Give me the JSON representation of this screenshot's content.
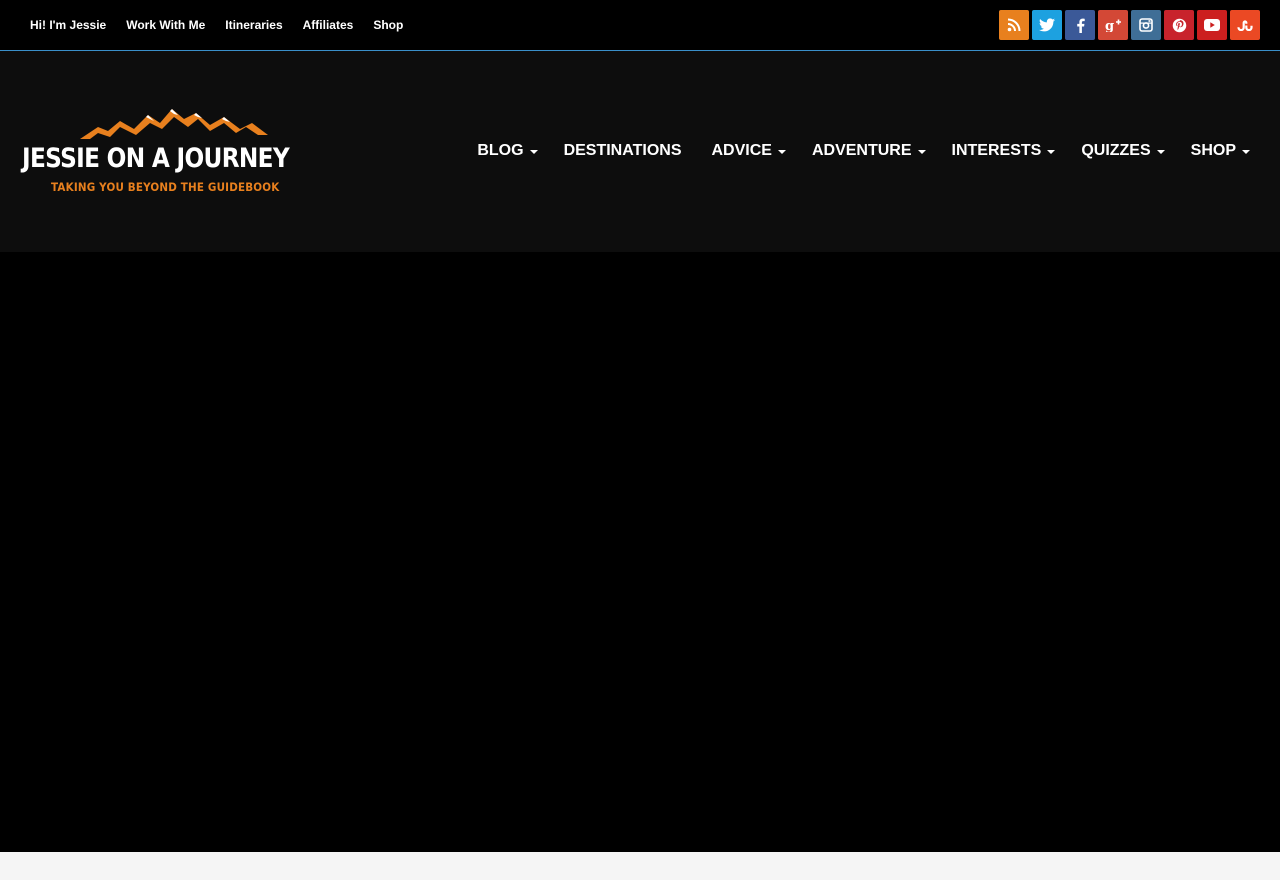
{
  "top_links": [
    "Hi! I'm Jessie",
    "Work With Me",
    "Itineraries",
    "Affiliates",
    "Shop"
  ],
  "social": [
    {
      "name": "rss-icon",
      "color": "#e8801e"
    },
    {
      "name": "twitter-icon",
      "color": "#1da1e0"
    },
    {
      "name": "facebook-icon",
      "color": "#3b5998"
    },
    {
      "name": "google-plus-icon",
      "color": "#d34836"
    },
    {
      "name": "instagram-icon",
      "color": "#3f6e96"
    },
    {
      "name": "pinterest-icon",
      "color": "#c8232c"
    },
    {
      "name": "youtube-icon",
      "color": "#cc1f1f"
    },
    {
      "name": "stumbleupon-icon",
      "color": "#eb4924"
    }
  ],
  "logo": {
    "title": "JESSIE ON A JOURNEY",
    "tagline": "TAKING YOU BEYOND THE GUIDEBOOK",
    "accent_color": "#e8801e"
  },
  "nav": [
    {
      "label": "BLOG",
      "dropdown": true
    },
    {
      "label": "DESTINATIONS",
      "dropdown": false
    },
    {
      "label": "ADVICE",
      "dropdown": true
    },
    {
      "label": "ADVENTURE",
      "dropdown": true
    },
    {
      "label": "INTERESTS",
      "dropdown": true
    },
    {
      "label": "QUIZZES",
      "dropdown": true
    },
    {
      "label": "SHOP",
      "dropdown": true
    }
  ],
  "colors": {
    "topbar_bg": "#000000",
    "topbar_border": "#3a8fc9",
    "header_bg": "#0d0d0d",
    "hero_bg": "#000000",
    "footer_bg": "#f5f5f5"
  }
}
